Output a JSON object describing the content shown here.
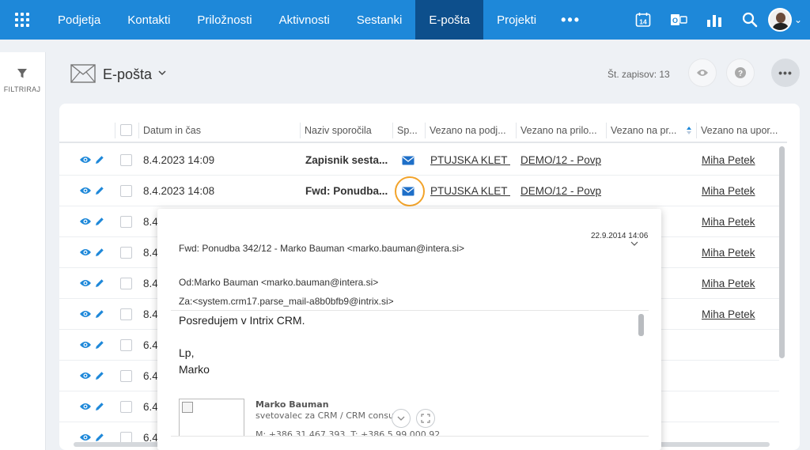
{
  "nav": {
    "items": [
      {
        "label": "Podjetja",
        "active": false
      },
      {
        "label": "Kontakti",
        "active": false
      },
      {
        "label": "Priložnosti",
        "active": false
      },
      {
        "label": "Aktivnosti",
        "active": false
      },
      {
        "label": "Sestanki",
        "active": false
      },
      {
        "label": "E-pošta",
        "active": true
      },
      {
        "label": "Projekti",
        "active": false
      }
    ],
    "more": "•••",
    "calendar_day": "14",
    "icons": [
      "apps-grid-icon",
      "calendar-icon",
      "outlook-icon",
      "reports-icon",
      "search-icon",
      "user-avatar"
    ],
    "colors": {
      "bar": "#1e88d9",
      "active": "#0d4f8c"
    }
  },
  "filter": {
    "label": "FILTRIRAJ"
  },
  "header": {
    "title": "E-pošta",
    "count": "Št. zapisov: 13"
  },
  "table": {
    "columns": [
      "Datum in čas",
      "Naziv sporočila",
      "Sp...",
      "Vezano na podj...",
      "Vezano na prilo...",
      "Vezano na pr...",
      "Vezano na upor..."
    ],
    "rows": [
      {
        "date": "8.4.2023 14:09",
        "subject": "Zapisnik sesta...",
        "company": "PTUJSKA KLET d",
        "opp": "DEMO/12 - Povp",
        "user": "Miha Petek"
      },
      {
        "date": "8.4.2023 14:08",
        "subject": "Fwd: Ponudba...",
        "company": "PTUJSKA KLET d",
        "opp": "DEMO/12 - Povp",
        "user": "Miha Petek"
      },
      {
        "date": "8.4",
        "subject": "",
        "company": "",
        "opp": "",
        "user": "Miha Petek"
      },
      {
        "date": "8.4",
        "subject": "",
        "company": "",
        "opp": "",
        "user": "Miha Petek"
      },
      {
        "date": "8.4",
        "subject": "",
        "company": "",
        "opp": "",
        "user": "Miha Petek"
      },
      {
        "date": "8.4",
        "subject": "",
        "company": "",
        "opp": "",
        "user": "Miha Petek"
      },
      {
        "date": "6.4",
        "subject": "",
        "company": "",
        "opp": "",
        "user": ""
      },
      {
        "date": "6.4",
        "subject": "",
        "company": "",
        "opp": "",
        "user": ""
      },
      {
        "date": "6.4",
        "subject": "",
        "company": "",
        "opp": "",
        "user": ""
      },
      {
        "date": "6.4",
        "subject": "",
        "company": "",
        "opp": "",
        "user": ""
      }
    ]
  },
  "preview": {
    "date": "22.9.2014 14:06",
    "subject": "Fwd: Ponudba 342/12 - Marko Bauman <marko.bauman@intera.si>",
    "from": "Od:Marko Bauman <marko.bauman@intera.si>",
    "to": "Za:<system.crm17.parse_mail-a8b0bfb9@intrix.si>",
    "body": [
      "Posredujem v Intrix CRM.",
      "Lp,",
      "Marko"
    ],
    "signature": {
      "name": "Marko Bauman",
      "role": "svetovalec za CRM / CRM consu",
      "phone": "M: +386 31 467 393, T: +386 5 99 000 92"
    }
  }
}
